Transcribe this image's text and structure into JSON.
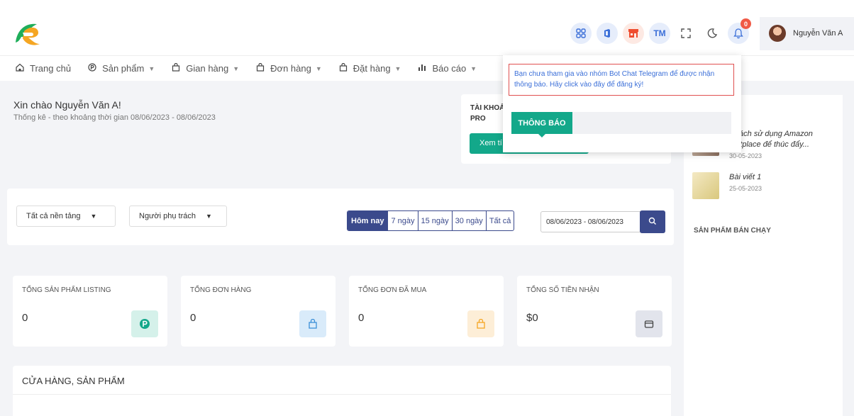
{
  "header": {
    "icons": [
      "apps-grid-icon",
      "office-icon",
      "store-icon",
      "tm-icon",
      "fullscreen-icon",
      "moon-icon",
      "bell-icon"
    ],
    "tm_label": "TM",
    "bell_count": "0",
    "user_name": "Nguyễn Văn A"
  },
  "nav": {
    "items": [
      {
        "label": "Trang chủ",
        "icon": "home-icon"
      },
      {
        "label": "Sản phẩm",
        "icon": "product-icon"
      },
      {
        "label": "Gian hàng",
        "icon": "bag-icon"
      },
      {
        "label": "Đơn hàng",
        "icon": "bag-icon"
      },
      {
        "label": "Đặt hàng",
        "icon": "bag-icon"
      },
      {
        "label": "Báo cáo",
        "icon": "bar-chart-icon"
      }
    ]
  },
  "welcome": {
    "greeting": "Xin chào Nguyễn Văn A!",
    "subtitle": "Thống kê - theo khoảng thời gian 08/06/2023 - 08/06/2023"
  },
  "account": {
    "label": "TÀI KHOẢ",
    "level": "PRO",
    "button": "Xem tí"
  },
  "popup": {
    "message": "Bạn chưa tham gia vào nhóm Bot Chat Telegram để được nhận thông báo. Hãy click vào đây để đăng ký!",
    "tab": "THÔNG BÁO"
  },
  "sidebar": {
    "posts": [
      {
        "title": "c cách sử dụng Amazon rketplace để thúc đẩy...",
        "date": "30-05-2023"
      },
      {
        "title": "Bài viết 1",
        "date": "25-05-2023"
      }
    ],
    "best_sellers_title": "SẢN PHẨM BÁN CHẠY"
  },
  "filter": {
    "platform": "Tất cả nền tảng",
    "owner": "Người phụ trách",
    "ranges": [
      "Hôm nay",
      "7 ngày",
      "15 ngày",
      "30 ngày",
      "Tất cả"
    ],
    "active_range": "Hôm nay",
    "date_range": "08/06/2023 - 08/06/2023"
  },
  "stats": [
    {
      "title": "TỔNG SẢN PHẨM LISTING",
      "value": "0",
      "icon": "product-icon",
      "color": "#d5f1ea"
    },
    {
      "title": "TỔNG ĐƠN HÀNG",
      "value": "0",
      "icon": "bag-icon",
      "color": "#d9ebfa"
    },
    {
      "title": "TỔNG ĐƠN ĐÃ MUA",
      "value": "0",
      "icon": "bag-icon",
      "color": "#fdeed7"
    },
    {
      "title": "TỔNG SỐ TIỀN NHẬN",
      "value": "$0",
      "icon": "wallet-icon",
      "color": "#e2e4ec"
    }
  ],
  "store": {
    "title": "CỬA HÀNG, SẢN PHẨM"
  }
}
